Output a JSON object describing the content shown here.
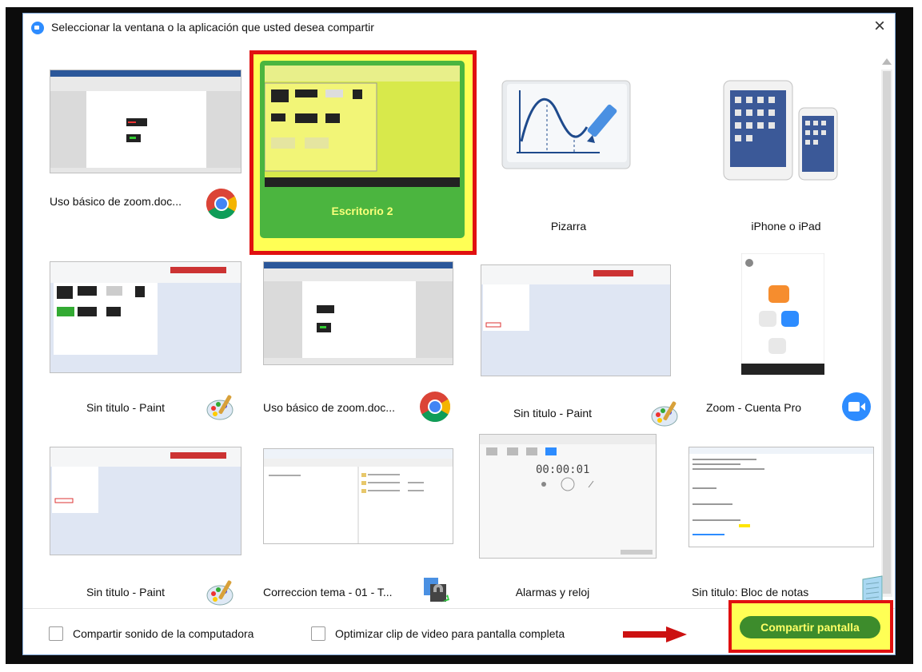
{
  "dialog": {
    "title": "Seleccionar la ventana o la aplicación que usted desea compartir",
    "close": "×"
  },
  "tiles": [
    {
      "label": "Uso básico de zoom.doc...",
      "icon": "chrome-icon"
    },
    {
      "label": "Escritorio 2",
      "selected": true
    },
    {
      "label": "Pizarra",
      "icon": "whiteboard-icon"
    },
    {
      "label": "iPhone o iPad",
      "icon": "ios-devices-icon"
    },
    {
      "label": "Sin titulo - Paint",
      "icon": "paint-icon"
    },
    {
      "label": "Uso básico de zoom.doc...",
      "icon": "chrome-icon"
    },
    {
      "label": "Sin titulo - Paint",
      "icon": "paint-icon"
    },
    {
      "label": "Zoom - Cuenta Pro",
      "icon": "zoom-icon"
    },
    {
      "label": "Sin titulo - Paint",
      "icon": "paint-icon"
    },
    {
      "label": "Correccion tema - 01 - T...",
      "icon": "network-share-icon"
    },
    {
      "label": "Alarmas y reloj",
      "icon": "clock-icon"
    },
    {
      "label": "Sin titulo: Bloc de notas",
      "icon": "notepad-icon"
    }
  ],
  "clock_preview": {
    "time": "00:00:01"
  },
  "footer": {
    "sound_label": "Compartir sonido de la computadora",
    "optimize_label": "Optimizar clip de video para pantalla completa",
    "share_label": "Compartir pantalla"
  },
  "colors": {
    "highlight_border": "#e01010",
    "highlight_fill": "#ffff55",
    "share_button": "#3d8c2c",
    "selected_tile": "#4bb53f"
  }
}
